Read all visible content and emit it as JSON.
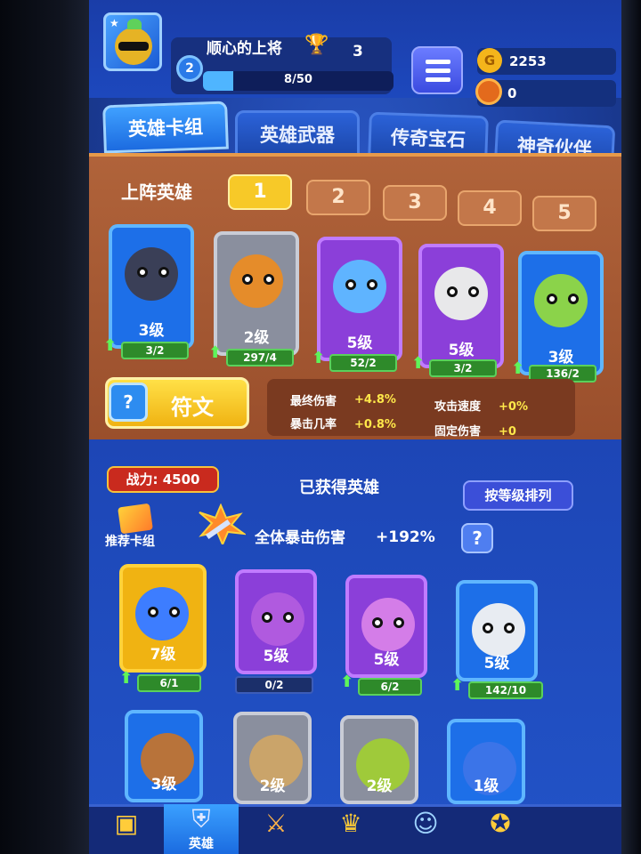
{
  "header": {
    "player_name": "顺心的上将",
    "level": "2",
    "trophies": "3",
    "xp": "8/50",
    "xp_fraction": 0.16,
    "gold": "2253",
    "gems": "0",
    "gold_icon_glyph": "G"
  },
  "tabs": [
    {
      "label": "英雄卡组",
      "active": true
    },
    {
      "label": "英雄武器",
      "active": false
    },
    {
      "label": "传奇宝石",
      "active": false
    },
    {
      "label": "神奇伙伴",
      "active": false
    }
  ],
  "lineup": {
    "title": "上阵英雄",
    "slots": [
      "1",
      "2",
      "3",
      "4",
      "5"
    ],
    "active_slot": "1",
    "heroes": [
      {
        "level": "3级",
        "progress": "3/2",
        "rarity": "blue",
        "color": "#1d6fe8",
        "upgradable": true
      },
      {
        "level": "2级",
        "progress": "297/4",
        "rarity": "gray",
        "color": "#8a8f9e",
        "upgradable": true
      },
      {
        "level": "5级",
        "progress": "52/2",
        "rarity": "purple",
        "color": "#8b3fd9",
        "upgradable": true
      },
      {
        "level": "5级",
        "progress": "3/2",
        "rarity": "purple",
        "color": "#8b3fd9",
        "upgradable": true
      },
      {
        "level": "3级",
        "progress": "136/2",
        "rarity": "blue",
        "color": "#1d6fe8",
        "upgradable": true
      }
    ]
  },
  "rune": {
    "label": "符文",
    "icon_glyph": "?"
  },
  "stats": [
    {
      "label": "最终伤害",
      "value": "+4.8%"
    },
    {
      "label": "攻击速度",
      "value": "+0%"
    },
    {
      "label": "暴击几率",
      "value": "+0.8%"
    },
    {
      "label": "固定伤害",
      "value": "+0"
    }
  ],
  "collection": {
    "power": "战力: 4500",
    "title": "已获得英雄",
    "sort_label": "按等级排列",
    "recommend_label": "推荐卡组",
    "crit_label": "全体暴击伤害",
    "crit_value": "+192%",
    "help_glyph": "?",
    "heroes_row1": [
      {
        "level": "7级",
        "progress": "6/1",
        "rarity": "gold",
        "upgradable": true
      },
      {
        "level": "5级",
        "progress": "0/2",
        "rarity": "purple",
        "upgradable": false
      },
      {
        "level": "5级",
        "progress": "6/2",
        "rarity": "purple",
        "upgradable": true
      },
      {
        "level": "5级",
        "progress": "142/10",
        "rarity": "blue",
        "upgradable": true
      }
    ],
    "heroes_row2": [
      {
        "level": "3级",
        "rarity": "blue"
      },
      {
        "level": "2级",
        "rarity": "gray"
      },
      {
        "level": "2级",
        "rarity": "gray"
      },
      {
        "level": "1级",
        "rarity": "blue"
      }
    ]
  },
  "nav": [
    {
      "label": "",
      "icon": "treasure-chest-icon",
      "glyph": "▣"
    },
    {
      "label": "英雄",
      "icon": "knight-helmet-icon",
      "glyph": "⛨",
      "active": true
    },
    {
      "label": "",
      "icon": "crossed-swords-icon",
      "glyph": "⚔"
    },
    {
      "label": "",
      "icon": "guild-shield-icon",
      "glyph": "♛"
    },
    {
      "label": "",
      "icon": "friends-icon",
      "glyph": "☺"
    },
    {
      "label": "",
      "icon": "compass-icon",
      "glyph": "✪"
    }
  ],
  "colors": {
    "gold_rarity": "#f0b312",
    "purple_rarity": "#8b3fd9",
    "blue_rarity": "#1d6fe8",
    "gray_rarity": "#8a8f9e",
    "upgrade_green": "#5ad15b",
    "stat_value": "#ffe84a"
  }
}
